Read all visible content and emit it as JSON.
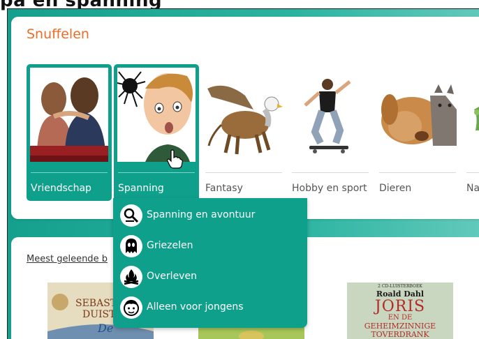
{
  "page": {
    "heading": "pa en spanning"
  },
  "section": {
    "title": "Snuffelen"
  },
  "categories": [
    {
      "label": "Vriendschap",
      "icon": "friends-image"
    },
    {
      "label": "Spanning",
      "icon": "scared-boy-spider-image"
    },
    {
      "label": "Fantasy",
      "icon": "griffin-image"
    },
    {
      "label": "Hobby en sport",
      "icon": "skateboarder-image"
    },
    {
      "label": "Dieren",
      "icon": "dog-cat-image"
    },
    {
      "label": "Na",
      "icon": "nature-image"
    }
  ],
  "dropdown": {
    "items": [
      {
        "label": "Spanning en avontuur",
        "icon": "magnifier-icon"
      },
      {
        "label": "Griezelen",
        "icon": "ghost-icon"
      },
      {
        "label": "Overleven",
        "icon": "campfire-icon"
      },
      {
        "label": "Alleen voor jongens",
        "icon": "boy-face-icon"
      }
    ]
  },
  "most_read": {
    "title": "Meest geleende b"
  },
  "books": [
    {
      "text_line1": "SEBASTI",
      "text_line2": "DUIST",
      "text_line3": "De"
    },
    {
      "text_line1": "2 CD-LUISTERBOEK",
      "author": "Roald Dahl",
      "title_line1": "JORIS",
      "title_line2": "EN DE",
      "title_line3": "GEHEIMZINNIGE",
      "title_line4": "TOVERDRANK"
    }
  ],
  "colors": {
    "accent": "#0fa08c",
    "title": "#ec6d27"
  }
}
